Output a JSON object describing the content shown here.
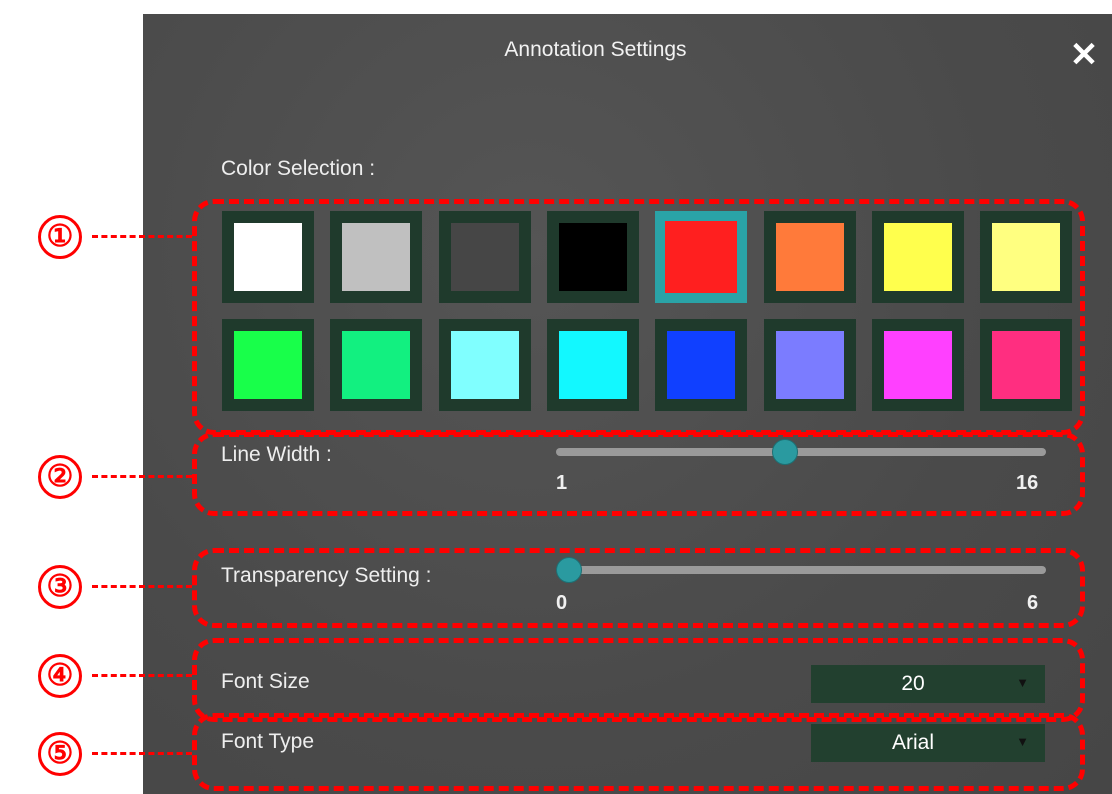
{
  "dialog": {
    "title": "Annotation Settings",
    "close_glyph": "✕"
  },
  "color_selection": {
    "label": "Color Selection :",
    "selected_index": 4,
    "swatches": [
      "#ffffff",
      "#c0c0c0",
      "#464646",
      "#000000",
      "#ff1f1f",
      "#ff7a3a",
      "#ffff4d",
      "#ffff80",
      "#18ff4a",
      "#12f080",
      "#80ffff",
      "#12f8ff",
      "#1040ff",
      "#7b7cff",
      "#ff40ff",
      "#ff2e80"
    ]
  },
  "line_width": {
    "label": "Line Width :",
    "min_label": "1",
    "max_label": "16",
    "min": 1,
    "max": 16,
    "value": 8
  },
  "transparency": {
    "label": "Transparency Setting :",
    "min_label": "0",
    "max_label": "6",
    "min": 0,
    "max": 6,
    "value": 0
  },
  "font_size": {
    "label": "Font Size",
    "value": "20"
  },
  "font_type": {
    "label": "Font Type",
    "value": "Arial"
  },
  "callouts": [
    "①",
    "②",
    "③",
    "④",
    "⑤"
  ],
  "colors": {
    "panel": "#4b4b4b",
    "highlight": "#ff0000",
    "accent": "#2aa3a7",
    "control_bg": "#22402f"
  }
}
